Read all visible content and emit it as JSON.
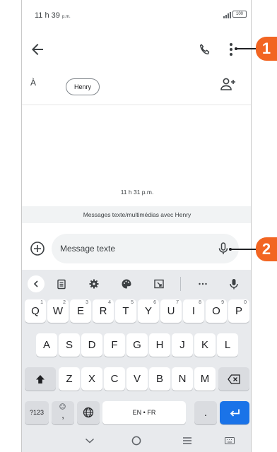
{
  "status": {
    "time": "11 h 39",
    "time_suffix": "p.m.",
    "battery": "100"
  },
  "conversation": {
    "to_label": "À",
    "recipient_chip": "Henry",
    "timestamp": "11 h 31 p.m.",
    "info_banner": "Messages texte/multimédias avec Henry"
  },
  "compose": {
    "placeholder": "Message texte"
  },
  "keyboard": {
    "row1": [
      {
        "key": "Q",
        "num": "1"
      },
      {
        "key": "W",
        "num": "2"
      },
      {
        "key": "E",
        "num": "3"
      },
      {
        "key": "R",
        "num": "4"
      },
      {
        "key": "T",
        "num": "5"
      },
      {
        "key": "Y",
        "num": "6"
      },
      {
        "key": "U",
        "num": "7"
      },
      {
        "key": "I",
        "num": "8"
      },
      {
        "key": "O",
        "num": "9"
      },
      {
        "key": "P",
        "num": "0"
      }
    ],
    "row2": [
      "A",
      "S",
      "D",
      "F",
      "G",
      "H",
      "J",
      "K",
      "L"
    ],
    "row3": [
      "Z",
      "X",
      "C",
      "V",
      "B",
      "N",
      "M"
    ],
    "sym_key": "?123",
    "emoji_key": ",",
    "space_label": "EN • FR",
    "period_key": "."
  },
  "callouts": [
    "1",
    "2"
  ],
  "colors": {
    "accent": "#1a73e8",
    "callout": "#f26522",
    "keyboard_bg": "#e8eaed"
  },
  "icons": [
    "back-arrow-icon",
    "phone-icon",
    "more-vert-icon",
    "add-person-icon",
    "add-circle-icon",
    "mic-icon",
    "clipboard-icon",
    "settings-icon",
    "palette-icon",
    "resize-icon",
    "backspace-icon",
    "shift-icon",
    "enter-icon",
    "globe-icon"
  ]
}
